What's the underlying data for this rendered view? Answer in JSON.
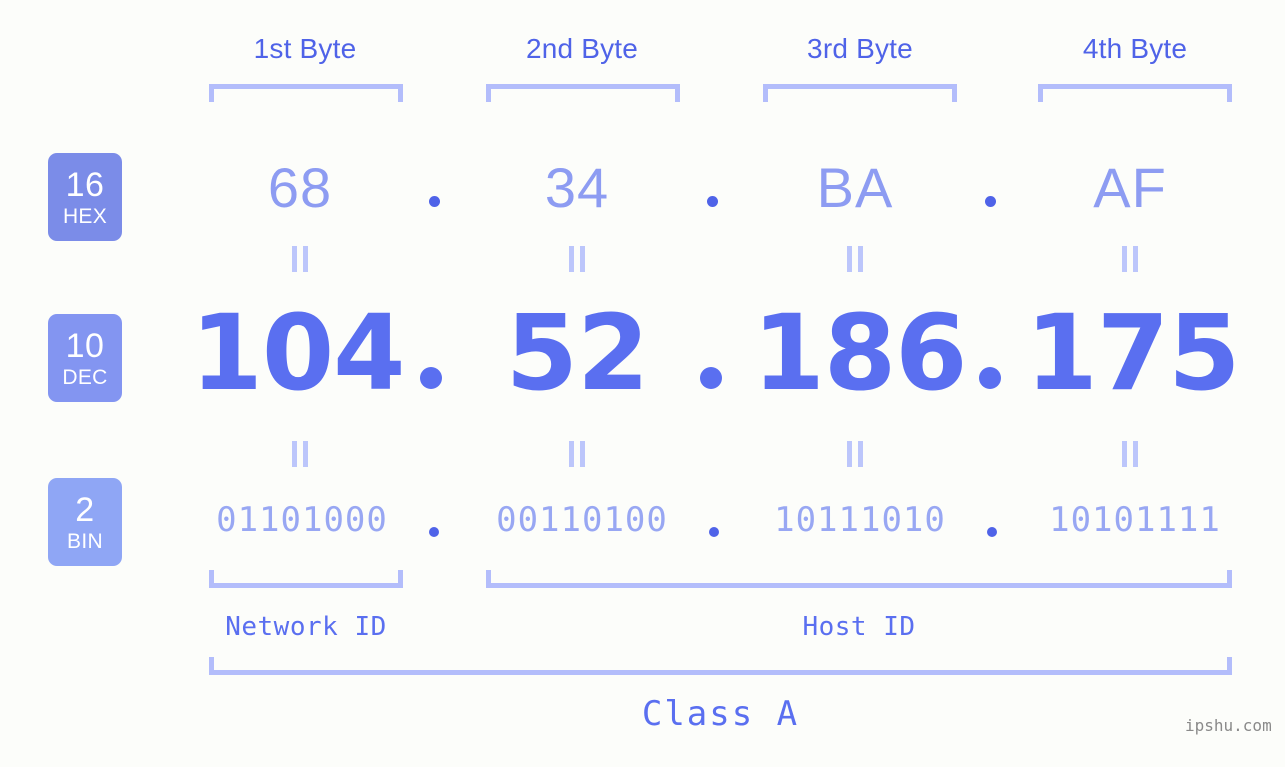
{
  "background_color": "#fcfdfa",
  "accent_color": "#5a6ff0",
  "bracket_color": "#b3bdfb",
  "header": {
    "byte_labels": [
      {
        "label": "1st Byte"
      },
      {
        "label": "2nd Byte"
      },
      {
        "label": "3rd Byte"
      },
      {
        "label": "4th Byte"
      }
    ]
  },
  "rows": {
    "hex": {
      "badge_number": "16",
      "badge_name": "HEX",
      "badge_color": "#7b8ce8",
      "values": [
        "68",
        "34",
        "BA",
        "AF"
      ],
      "separator": "."
    },
    "dec": {
      "badge_number": "10",
      "badge_name": "DEC",
      "badge_color": "#8395f1",
      "values": [
        "104",
        "52",
        "186",
        "175"
      ],
      "separator": "."
    },
    "bin": {
      "badge_number": "2",
      "badge_name": "BIN",
      "badge_color": "#8fa6f5",
      "values": [
        "01101000",
        "00110100",
        "10111010",
        "10101111"
      ],
      "separator": "."
    }
  },
  "footer": {
    "network_id_label": "Network ID",
    "host_id_label": "Host ID",
    "class_label": "Class A",
    "watermark": "ipshu.com"
  }
}
